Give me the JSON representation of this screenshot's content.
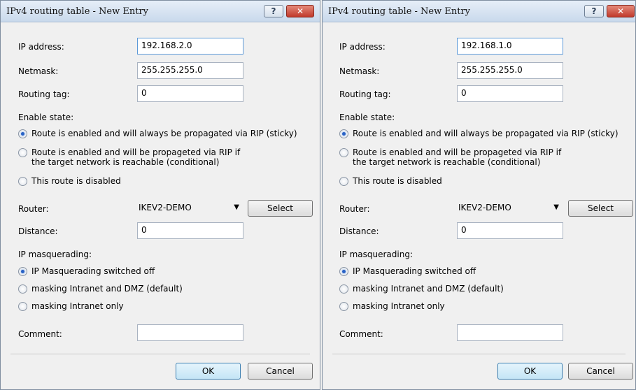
{
  "dialogs": [
    {
      "title": "IPv4 routing table - New Entry",
      "help_label": "?",
      "close_label": "✕",
      "fields": {
        "ip_label": "IP address:",
        "ip_value": "192.168.2.0",
        "netmask_label": "Netmask:",
        "netmask_value": "255.255.255.0",
        "routing_tag_label": "Routing tag:",
        "routing_tag_value": "0"
      },
      "enable_state": {
        "heading": "Enable state:",
        "option1": "Route is enabled and will always be propagated via RIP (sticky)",
        "option2": "Route is enabled and will be propageted via RIP if the target network is reachable (conditional)",
        "option3": "This route is disabled"
      },
      "router": {
        "label": "Router:",
        "value": "IKEV2-DEMO",
        "select_label": "Select"
      },
      "distance": {
        "label": "Distance:",
        "value": "0"
      },
      "masquerading": {
        "heading": "IP masquerading:",
        "option1": "IP Masquerading switched off",
        "option2": "masking Intranet and DMZ (default)",
        "option3": "masking Intranet only"
      },
      "comment": {
        "label": "Comment:",
        "value": ""
      },
      "buttons": {
        "ok": "OK",
        "cancel": "Cancel"
      }
    },
    {
      "title": "IPv4 routing table - New Entry",
      "help_label": "?",
      "close_label": "✕",
      "fields": {
        "ip_label": "IP address:",
        "ip_value": "192.168.1.0",
        "netmask_label": "Netmask:",
        "netmask_value": "255.255.255.0",
        "routing_tag_label": "Routing tag:",
        "routing_tag_value": "0"
      },
      "enable_state": {
        "heading": "Enable state:",
        "option1": "Route is enabled and will always be propagated via RIP (sticky)",
        "option2": "Route is enabled and will be propageted via RIP if the target network is reachable (conditional)",
        "option3": "This route is disabled"
      },
      "router": {
        "label": "Router:",
        "value": "IKEV2-DEMO",
        "select_label": "Select"
      },
      "distance": {
        "label": "Distance:",
        "value": "0"
      },
      "masquerading": {
        "heading": "IP masquerading:",
        "option1": "IP Masquerading switched off",
        "option2": "masking Intranet and DMZ (default)",
        "option3": "masking Intranet only"
      },
      "comment": {
        "label": "Comment:",
        "value": ""
      },
      "buttons": {
        "ok": "OK",
        "cancel": "Cancel"
      }
    }
  ]
}
